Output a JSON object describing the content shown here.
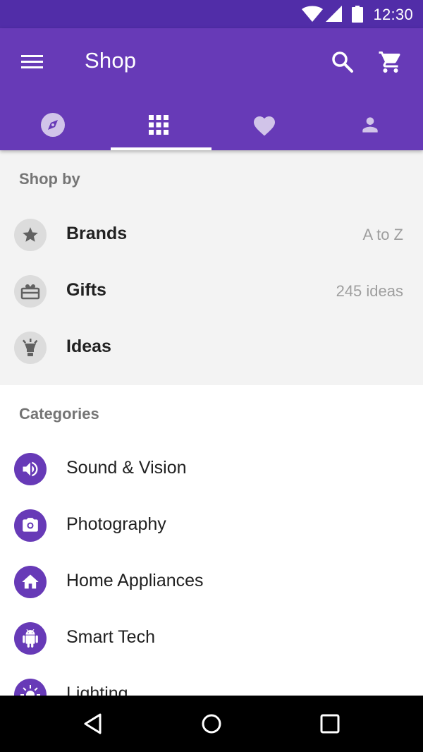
{
  "status_bar": {
    "time": "12:30",
    "icons": [
      "wifi-icon",
      "signal-icon",
      "battery-icon"
    ]
  },
  "app_bar": {
    "title": "Shop",
    "icons": {
      "menu": "menu-icon",
      "search": "search-icon",
      "cart": "cart-icon"
    }
  },
  "tabs": [
    {
      "icon": "compass-icon",
      "active": false
    },
    {
      "icon": "grid-icon",
      "active": true
    },
    {
      "icon": "heart-icon",
      "active": false
    },
    {
      "icon": "person-icon",
      "active": false
    }
  ],
  "shop_by": {
    "header": "Shop by",
    "items": [
      {
        "label": "Brands",
        "secondary": "A to Z",
        "icon": "star-icon"
      },
      {
        "label": "Gifts",
        "secondary": "245 ideas",
        "icon": "gift-icon"
      },
      {
        "label": "Ideas",
        "secondary": "",
        "icon": "lightbulb-icon"
      }
    ]
  },
  "categories": {
    "header": "Categories",
    "items": [
      {
        "label": "Sound & Vision",
        "icon": "speaker-icon"
      },
      {
        "label": "Photography",
        "icon": "camera-icon"
      },
      {
        "label": "Home Appliances",
        "icon": "home-icon"
      },
      {
        "label": "Smart Tech",
        "icon": "android-icon"
      },
      {
        "label": "Lighting",
        "icon": "sun-icon"
      }
    ]
  },
  "colors": {
    "primary": "#673AB7",
    "primary_dark": "#512DA8",
    "shop_by_bg": "#F3F3F3",
    "text_primary": "#212121",
    "text_secondary": "#9E9E9E"
  }
}
